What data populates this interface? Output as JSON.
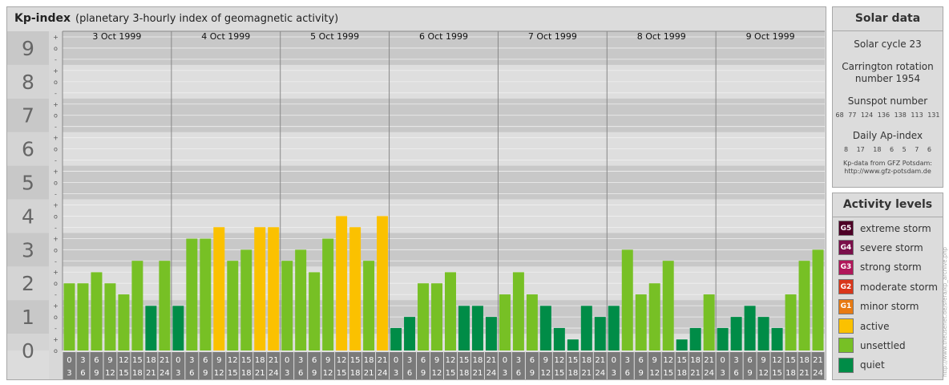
{
  "header": {
    "title": "Kp-index",
    "subtitle": "(planetary 3-hourly index of geomagnetic activity)"
  },
  "solar": {
    "title": "Solar data",
    "cycle": "Solar cycle 23",
    "carrington_line1": "Carrington rotation",
    "carrington_line2": "number 1954",
    "sunspot_label": "Sunspot number",
    "sunspot_values": "68  77  124 136 138 113 131",
    "ap_label": "Daily Ap-index",
    "ap_values": "8  17  18  6  5  7  6",
    "source_line1": "Kp-data from GFZ Potsdam:",
    "source_line2": "http://www.gfz-potsdam.de"
  },
  "activity": {
    "title": "Activity levels",
    "levels": [
      {
        "code": "G5",
        "label": "extreme storm",
        "color": "#4d0026"
      },
      {
        "code": "G4",
        "label": "severe storm",
        "color": "#7a0f4a"
      },
      {
        "code": "G3",
        "label": "strong storm",
        "color": "#b0175a"
      },
      {
        "code": "G2",
        "label": "moderate storm",
        "color": "#d9361a"
      },
      {
        "code": "G1",
        "label": "minor storm",
        "color": "#e87a12"
      },
      {
        "code": "",
        "label": "active",
        "color": "#fbc100"
      },
      {
        "code": "",
        "label": "unsettled",
        "color": "#77c025"
      },
      {
        "code": "",
        "label": "quiet",
        "color": "#008c47"
      }
    ]
  },
  "credit": "http://www.theusenet.de/sfera/kp_archive.php",
  "chart_data": {
    "type": "bar",
    "title": "Kp-index",
    "y_ticks": [
      "0",
      "1",
      "2",
      "3",
      "4",
      "5",
      "6",
      "7",
      "8",
      "9"
    ],
    "y_subticks": [
      "o",
      "+",
      "-"
    ],
    "ylim": [
      0,
      9
    ],
    "days": [
      "3 Oct 1999",
      "4 Oct 1999",
      "5 Oct 1999",
      "6 Oct 1999",
      "7 Oct 1999",
      "8 Oct 1999",
      "9 Oct 1999"
    ],
    "hour_start": [
      "0",
      "3",
      "6",
      "9",
      "12",
      "15",
      "18",
      "21"
    ],
    "hour_end": [
      "3",
      "6",
      "9",
      "12",
      "15",
      "18",
      "21",
      "24"
    ],
    "values": [
      [
        2.0,
        2.0,
        2.33,
        2.0,
        1.67,
        2.67,
        1.33,
        2.67
      ],
      [
        1.33,
        3.33,
        3.33,
        3.67,
        2.67,
        3.0,
        3.67,
        3.67
      ],
      [
        2.67,
        3.0,
        2.33,
        3.33,
        4.0,
        3.67,
        2.67,
        4.0
      ],
      [
        0.67,
        1.0,
        2.0,
        2.0,
        2.33,
        1.33,
        1.33,
        1.0
      ],
      [
        1.67,
        2.33,
        1.67,
        1.33,
        0.67,
        0.33,
        1.33,
        1.0
      ],
      [
        1.33,
        3.0,
        1.67,
        2.0,
        2.67,
        0.33,
        0.67,
        1.67
      ],
      [
        0.67,
        1.0,
        1.33,
        1.0,
        0.67,
        1.67,
        2.67,
        3.0
      ]
    ],
    "colors": {
      "quiet": "#008c47",
      "unsettled": "#77c025",
      "active": "#fbc100"
    }
  }
}
